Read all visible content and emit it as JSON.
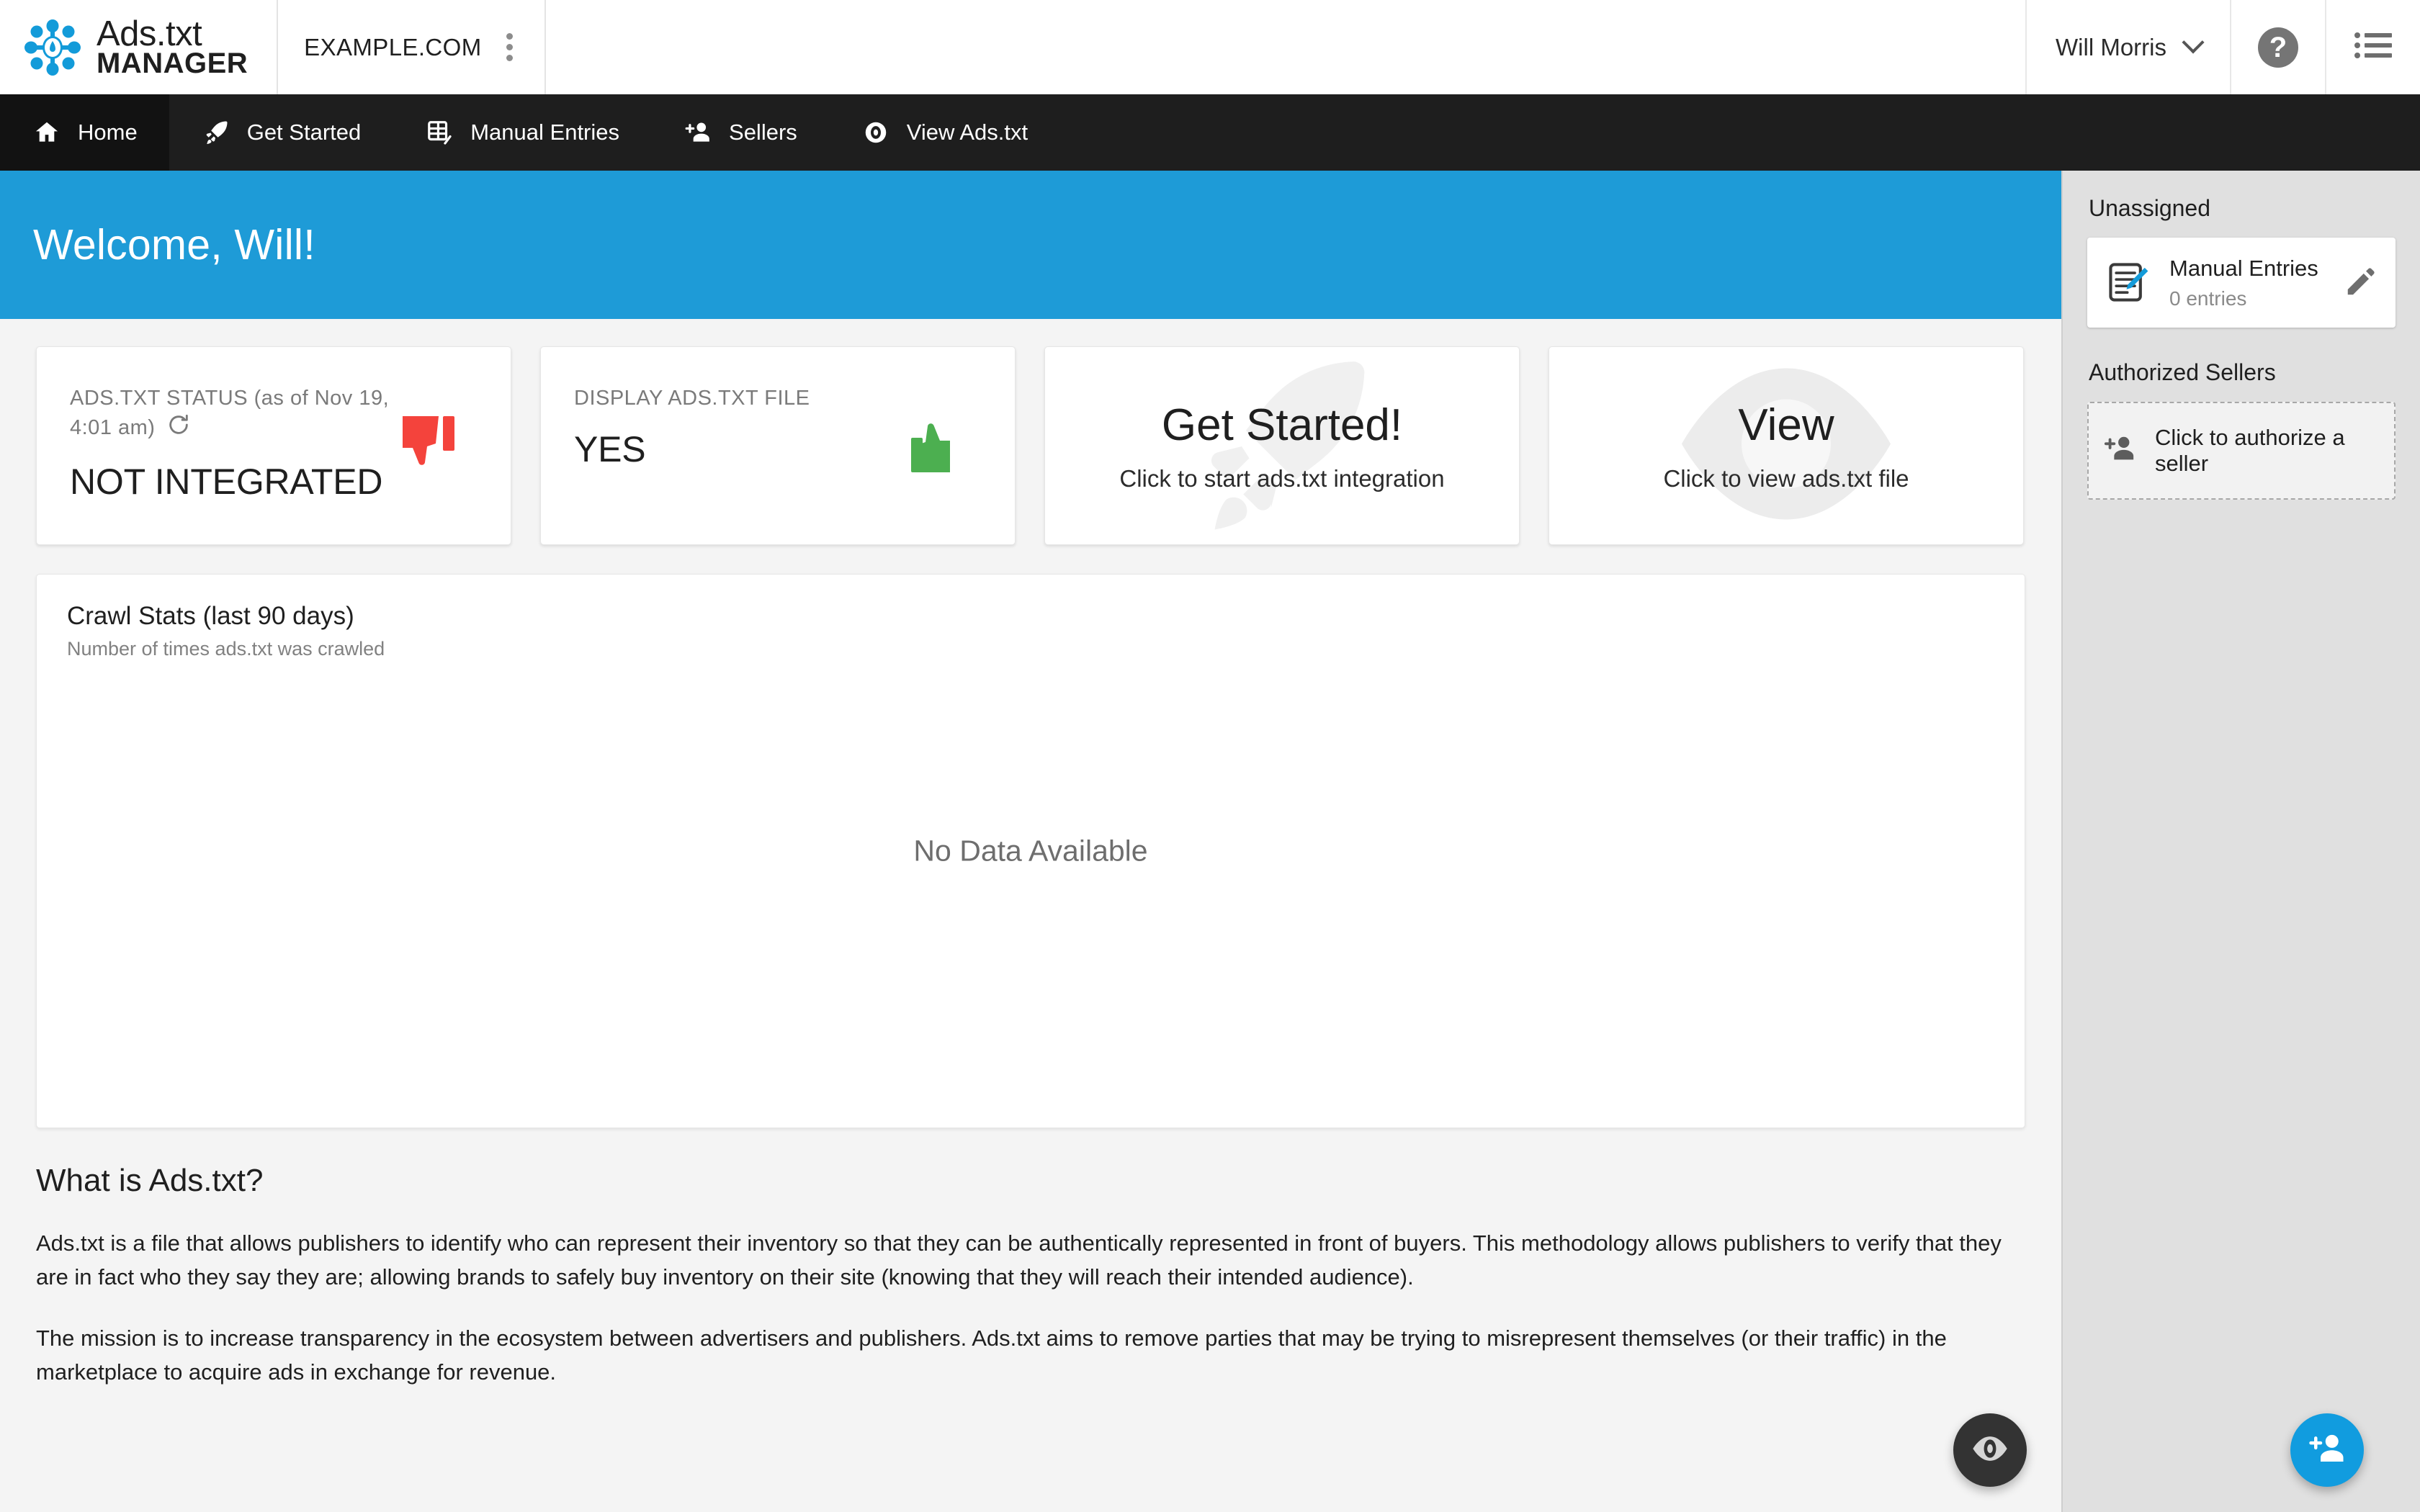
{
  "brand": {
    "line1": "Ads.txt",
    "line2": "MANAGER",
    "logo_icon": "adstxt-manager-logo-icon"
  },
  "topbar": {
    "site_name": "EXAMPLE.COM",
    "site_menu_icon": "kebab-menu-icon",
    "user_name": "Will Morris",
    "user_chevron_icon": "chevron-down-icon",
    "help_label": "?",
    "help_icon": "help-circle-icon",
    "list_icon": "list-menu-icon"
  },
  "nav": {
    "items": [
      {
        "label": "Home",
        "icon": "home-icon",
        "active": true
      },
      {
        "label": "Get Started",
        "icon": "rocket-icon",
        "active": false
      },
      {
        "label": "Manual Entries",
        "icon": "manual-entries-icon",
        "active": false
      },
      {
        "label": "Sellers",
        "icon": "add-person-icon",
        "active": false
      },
      {
        "label": "View Ads.txt",
        "icon": "eye-icon",
        "active": false
      }
    ]
  },
  "welcome": {
    "title": "Welcome, Will!"
  },
  "cards": {
    "status": {
      "caption": "ADS.TXT STATUS (as of Nov 19, 4:01 am)",
      "refresh_icon": "refresh-icon",
      "value": "NOT INTEGRATED",
      "indicator_icon": "thumb-down-icon",
      "indicator_color": "#F4433C"
    },
    "display": {
      "caption": "DISPLAY ADS.TXT FILE",
      "value": "YES",
      "indicator_icon": "thumb-up-icon",
      "indicator_color": "#4CAF50"
    },
    "get_started": {
      "title": "Get Started!",
      "subtitle": "Click to start ads.txt integration",
      "watermark_icon": "rocket-watermark-icon"
    },
    "view": {
      "title": "View",
      "subtitle": "Click to view ads.txt file",
      "watermark_icon": "eye-watermark-icon"
    }
  },
  "crawl_stats": {
    "title_bold": "Crawl Stats",
    "title_rest": " (last 90 days)",
    "subtitle": "Number of times ads.txt was crawled",
    "empty_message": "No Data Available"
  },
  "chart_data": {
    "type": "line",
    "title": "Crawl Stats (last 90 days)",
    "subtitle": "Number of times ads.txt was crawled",
    "xlabel": "",
    "ylabel": "",
    "x": [],
    "values": [],
    "series": [],
    "empty": true,
    "empty_message": "No Data Available",
    "grid": false,
    "legend": "none"
  },
  "about": {
    "heading": "What is Ads.txt?",
    "paragraph1": "Ads.txt is a file that allows publishers to identify who can represent their inventory so that they can be authentically represented in front of buyers. This methodology allows publishers to verify that they are in fact who they say they are; allowing brands to safely buy inventory on their site (knowing that they will reach their intended audience).",
    "paragraph2": "The mission is to increase transparency in the ecosystem between advertisers and publishers. Ads.txt aims to remove parties that may be trying to misrepresent themselves (or their traffic) in the marketplace to acquire ads in exchange for revenue."
  },
  "sidebar": {
    "unassigned_heading": "Unassigned",
    "manual_entries": {
      "title": "Manual Entries",
      "count_label": "0 entries",
      "icon": "note-edit-icon",
      "edit_icon": "pencil-icon"
    },
    "authorized_sellers_heading": "Authorized Sellers",
    "authorize_button": {
      "label": "Click to authorize a seller",
      "icon": "add-person-icon"
    }
  },
  "fabs": {
    "view": {
      "icon": "eye-icon",
      "color": "#333333"
    },
    "add_seller": {
      "icon": "add-person-icon",
      "color": "#119CDF"
    }
  }
}
